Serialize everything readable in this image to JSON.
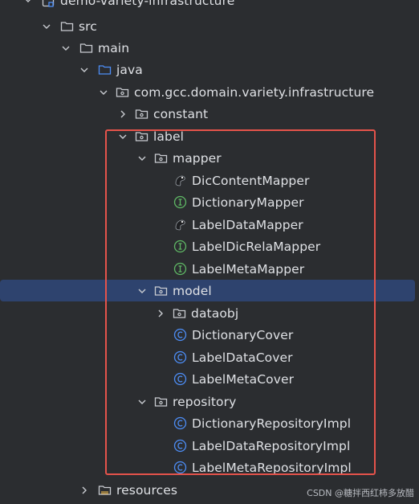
{
  "tree": {
    "root": "demo-variety-infrastructure",
    "src": "src",
    "main": "main",
    "java": "java",
    "package": "com.gcc.domain.variety.infrastructure",
    "constant": "constant",
    "label": "label",
    "mapper": "mapper",
    "mapper_items": [
      {
        "name": "DicContentMapper",
        "icon": "mybatis-icon"
      },
      {
        "name": "DictionaryMapper",
        "icon": "interface-icon"
      },
      {
        "name": "LabelDataMapper",
        "icon": "mybatis-icon"
      },
      {
        "name": "LabelDicRelaMapper",
        "icon": "interface-icon"
      },
      {
        "name": "LabelMetaMapper",
        "icon": "interface-icon"
      }
    ],
    "model": "model",
    "dataobj": "dataobj",
    "model_items": [
      "DictionaryCover",
      "LabelDataCover",
      "LabelMetaCover"
    ],
    "repository": "repository",
    "repository_items": [
      "DictionaryRepositoryImpl",
      "LabelDataRepositoryImpl",
      "LabelMetaRepositoryImpl"
    ],
    "resources": "resources"
  },
  "watermark": "CSDN @糖拌西红柿多放醋",
  "colors": {
    "background": "#2b2d30",
    "selection": "#2e436e",
    "highlight_border": "#e5534b",
    "folder_blue": "#4d8ef7",
    "class_blue": "#4d8ef7",
    "interface_green": "#5fb865",
    "text": "#dfe1e5"
  }
}
